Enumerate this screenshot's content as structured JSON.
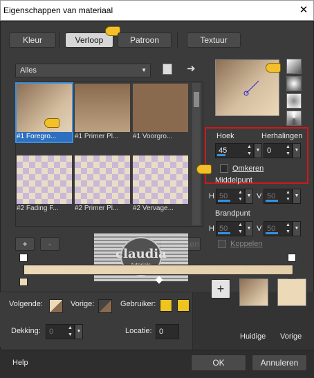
{
  "window": {
    "title": "Eigenschappen van materiaal",
    "close_glyph": "✕"
  },
  "tabs": [
    {
      "label": "Kleur"
    },
    {
      "label": "Verloop",
      "active": true
    },
    {
      "label": "Patroon"
    },
    {
      "label": "Textuur"
    }
  ],
  "gallery": {
    "filter_value": "Alles",
    "items": [
      {
        "label": "#1 Foregro...",
        "selected": true
      },
      {
        "label": "#1 Primer Pl..."
      },
      {
        "label": "#1 Voorgro..."
      },
      {
        "label": "#2 Fading F..."
      },
      {
        "label": "#2 Primer Pl..."
      },
      {
        "label": "#2 Vervage..."
      }
    ],
    "add_glyph": "+",
    "remove_glyph": "-",
    "dim_button_label": "Bewerken"
  },
  "settings": {
    "hoek_label": "Hoek",
    "hoek_value": "45",
    "herhalingen_label": "Herhalingen",
    "herhalingen_value": "0",
    "omkeren_label": "Omkeren",
    "middelpunt_label": "Middelpunt",
    "brandpunt_label": "Brandpunt",
    "h_label": "H",
    "v_label": "V",
    "mid_h": "50",
    "mid_v": "50",
    "brand_h": "50",
    "brand_v": "50",
    "koppelen_label": "Koppelen"
  },
  "watermark": {
    "text": "claudia",
    "subtext": "tutorials"
  },
  "footer": {
    "volgende_label": "Volgende:",
    "vorige_label": "Vorige:",
    "gebruiker_label": "Gebruiker:",
    "dekking_label": "Dekking:",
    "dekking_value": "0",
    "locatie_label": "Locatie:",
    "locatie_value": "0",
    "huidige_label": "Huidige",
    "vorige_swatch_label": "Vorige",
    "help_label": "Help",
    "ok_label": "OK",
    "cancel_label": "Annuleren"
  },
  "colors": {
    "accent": "#3c8fdc",
    "highlight": "#d01818",
    "user_color": "#f0c420",
    "current_fg": "#8a6a4e",
    "current_bg": "#ecd9b8"
  }
}
